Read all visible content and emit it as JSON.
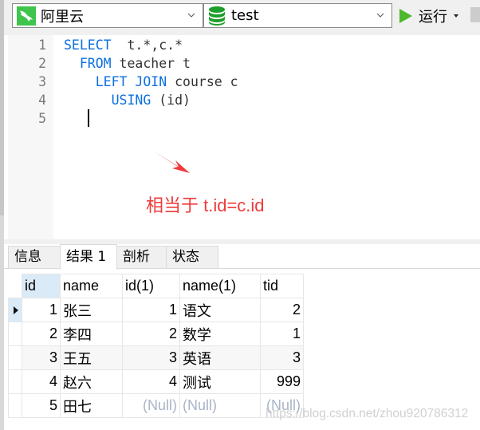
{
  "toolbar": {
    "connection": "阿里云",
    "connection_icon": "dolphin-connection-icon",
    "database": "test",
    "database_icon": "database-icon",
    "run_label": "运行",
    "stop_icon": "stop-icon"
  },
  "editor": {
    "lines": [
      {
        "n": "1",
        "tokens": [
          {
            "t": "SELECT",
            "k": "kw"
          },
          {
            "t": "  t.*,c.*",
            "k": "tx"
          }
        ],
        "indent": ""
      },
      {
        "n": "2",
        "tokens": [
          {
            "t": "FROM",
            "k": "kw"
          },
          {
            "t": " teacher t",
            "k": "tx"
          }
        ],
        "indent": "  "
      },
      {
        "n": "3",
        "tokens": [
          {
            "t": "LEFT JOIN",
            "k": "kw"
          },
          {
            "t": " course c",
            "k": "tx"
          }
        ],
        "indent": "    "
      },
      {
        "n": "4",
        "tokens": [
          {
            "t": "USING",
            "k": "kw"
          },
          {
            "t": " (id)",
            "k": "tx"
          }
        ],
        "indent": "      "
      },
      {
        "n": "5",
        "tokens": [],
        "indent": ""
      }
    ],
    "annotation": "相当于 t.id=c.id",
    "annotation_color": "#f03a3a"
  },
  "tabs": [
    {
      "label": "信息",
      "active": false
    },
    {
      "label": "结果 1",
      "active": true
    },
    {
      "label": "剖析",
      "active": false
    },
    {
      "label": "状态",
      "active": false
    }
  ],
  "results": {
    "columns": [
      "id",
      "name",
      "id(1)",
      "name(1)",
      "tid"
    ],
    "rows": [
      [
        "1",
        "张三",
        "1",
        "语文",
        "2"
      ],
      [
        "2",
        "李四",
        "2",
        "数学",
        "1"
      ],
      [
        "3",
        "王五",
        "3",
        "英语",
        "3"
      ],
      [
        "4",
        "赵六",
        "4",
        "测试",
        "999"
      ],
      [
        "5",
        "田七",
        "(Null)",
        "(Null)",
        "(Null)"
      ]
    ],
    "current_row": 0,
    "null_text": "(Null)"
  },
  "watermark": "https://blog.csdn.net/zhou920786312"
}
